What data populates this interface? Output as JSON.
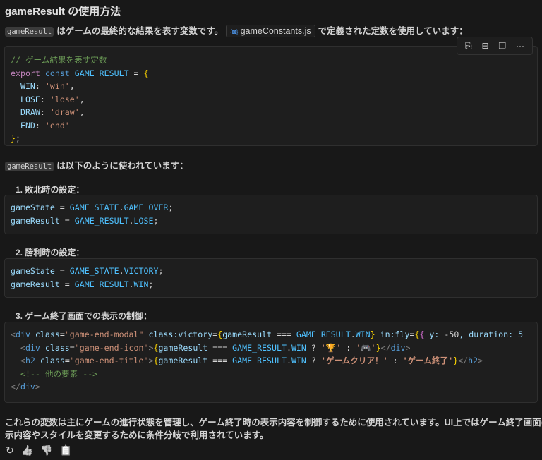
{
  "title": "gameResult の使用方法",
  "intro": {
    "code": "gameResult",
    "text1": "はゲームの最終的な結果を表す変数です。",
    "file": "gameConstants.js",
    "text2": "で定義された定数を使用しています："
  },
  "toolbar": {
    "apply": "⎘",
    "insert": "⊟",
    "copy": "❐",
    "more": "···"
  },
  "block1": [
    [
      [
        "// ゲーム結果を表す定数",
        "cm"
      ]
    ],
    [
      [
        "export",
        "kw"
      ],
      [
        " ",
        "pl"
      ],
      [
        "const",
        "st"
      ],
      [
        " ",
        "pl"
      ],
      [
        "GAME_RESULT",
        "cn"
      ],
      [
        " = ",
        "pl"
      ],
      [
        "{",
        "br"
      ]
    ],
    [
      [
        "  WIN",
        "vr"
      ],
      [
        ": ",
        "pl"
      ],
      [
        "'win'",
        "str"
      ],
      [
        ",",
        "pl"
      ]
    ],
    [
      [
        "  LOSE",
        "vr"
      ],
      [
        ": ",
        "pl"
      ],
      [
        "'lose'",
        "str"
      ],
      [
        ",",
        "pl"
      ]
    ],
    [
      [
        "  DRAW",
        "vr"
      ],
      [
        ": ",
        "pl"
      ],
      [
        "'draw'",
        "str"
      ],
      [
        ",",
        "pl"
      ]
    ],
    [
      [
        "  END",
        "vr"
      ],
      [
        ": ",
        "pl"
      ],
      [
        "'end'",
        "str"
      ]
    ],
    [
      [
        "}",
        "br"
      ],
      [
        ";",
        "pl"
      ]
    ]
  ],
  "usage": {
    "code": "gameResult",
    "text": "は以下のように使われています："
  },
  "items": [
    "1. 敗北時の設定：",
    "2. 勝利時の設定：",
    "3. ゲーム終了画面での表示の制御："
  ],
  "block2": [
    [
      [
        "gameState",
        "vr"
      ],
      [
        " = ",
        "pl"
      ],
      [
        "GAME_STATE",
        "cn"
      ],
      [
        ".",
        "pl"
      ],
      [
        "GAME_OVER",
        "cn"
      ],
      [
        ";",
        "pl"
      ]
    ],
    [
      [
        "gameResult",
        "vr"
      ],
      [
        " = ",
        "pl"
      ],
      [
        "GAME_RESULT",
        "cn"
      ],
      [
        ".",
        "pl"
      ],
      [
        "LOSE",
        "cn"
      ],
      [
        ";",
        "pl"
      ]
    ]
  ],
  "block3": [
    [
      [
        "gameState",
        "vr"
      ],
      [
        " = ",
        "pl"
      ],
      [
        "GAME_STATE",
        "cn"
      ],
      [
        ".",
        "pl"
      ],
      [
        "VICTORY",
        "cn"
      ],
      [
        ";",
        "pl"
      ]
    ],
    [
      [
        "gameResult",
        "vr"
      ],
      [
        " = ",
        "pl"
      ],
      [
        "GAME_RESULT",
        "cn"
      ],
      [
        ".",
        "pl"
      ],
      [
        "WIN",
        "cn"
      ],
      [
        ";",
        "pl"
      ]
    ]
  ],
  "block4": [
    [
      [
        "<",
        "gt"
      ],
      [
        "div",
        "tg"
      ],
      [
        " class",
        "vr"
      ],
      [
        "=",
        "pl"
      ],
      [
        "\"game-end-modal\"",
        "str"
      ],
      [
        " class:victory",
        "vr"
      ],
      [
        "=",
        "pl"
      ],
      [
        "{",
        "br"
      ],
      [
        "gameResult",
        "vr"
      ],
      [
        " === ",
        "pl"
      ],
      [
        "GAME_RESULT",
        "cn"
      ],
      [
        ".",
        "pl"
      ],
      [
        "WIN",
        "cn"
      ],
      [
        "}",
        "br"
      ],
      [
        " in:fly",
        "vr"
      ],
      [
        "=",
        "pl"
      ],
      [
        "{",
        "br"
      ],
      [
        "{",
        "br2"
      ],
      [
        " y: ",
        "vr"
      ],
      [
        "-50",
        ""
      ],
      [
        ", duration: 5",
        "vr"
      ]
    ],
    [
      [
        "  <",
        "gt"
      ],
      [
        "div",
        "tg"
      ],
      [
        " class",
        "vr"
      ],
      [
        "=",
        "pl"
      ],
      [
        "\"game-end-icon\"",
        "str"
      ],
      [
        ">",
        "gt"
      ],
      [
        "{",
        "br"
      ],
      [
        "gameResult",
        "vr"
      ],
      [
        " === ",
        "pl"
      ],
      [
        "GAME_RESULT",
        "cn"
      ],
      [
        ".",
        "pl"
      ],
      [
        "WIN",
        "cn"
      ],
      [
        " ? ",
        "pl"
      ],
      [
        "'🏆'",
        "str"
      ],
      [
        " : ",
        "pl"
      ],
      [
        "'🎮'",
        "str"
      ],
      [
        "}",
        "br"
      ],
      [
        "</",
        "gt"
      ],
      [
        "div",
        "tg"
      ],
      [
        ">",
        "gt"
      ]
    ],
    [
      [
        "  <",
        "gt"
      ],
      [
        "h2",
        "tg"
      ],
      [
        " class",
        "vr"
      ],
      [
        "=",
        "pl"
      ],
      [
        "\"game-end-title\"",
        "str"
      ],
      [
        ">",
        "gt"
      ],
      [
        "{",
        "br"
      ],
      [
        "gameResult",
        "vr"
      ],
      [
        " === ",
        "pl"
      ],
      [
        "GAME_RESULT",
        "cn"
      ],
      [
        ".",
        "pl"
      ],
      [
        "WIN",
        "cn"
      ],
      [
        " ? ",
        "pl"
      ],
      [
        "'ゲームクリア！'",
        "jp"
      ],
      [
        " : ",
        "pl"
      ],
      [
        "'ゲーム終了'",
        "jp"
      ],
      [
        "}",
        "br"
      ],
      [
        "</",
        "gt"
      ],
      [
        "h2",
        "tg"
      ],
      [
        ">",
        "gt"
      ]
    ],
    [
      [
        "  <!-- 他の要素 -->",
        "cm"
      ]
    ],
    [
      [
        "</",
        "gt"
      ],
      [
        "div",
        "tg"
      ],
      [
        ">",
        "gt"
      ]
    ]
  ],
  "summary": [
    "これらの変数は主にゲームの進行状態を管理し、ゲーム終了時の表示内容を制御するために使用されています。UI上ではゲーム終了画面の表",
    "示内容やスタイルを変更するために条件分岐で利用されています。"
  ],
  "feedback": {
    "retry": "↻",
    "up": "👍",
    "down": "👎",
    "copy": "📋"
  }
}
